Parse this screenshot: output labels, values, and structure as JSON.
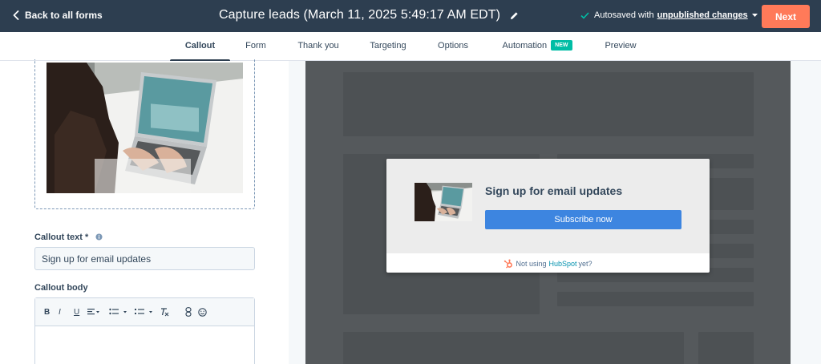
{
  "topbar": {
    "back_label": "Back to all forms",
    "title": "Capture leads (March 11, 2025 5:49:17 AM EDT)",
    "autosave_text": "Autosaved with",
    "autosave_link": "unpublished changes",
    "next_label": "Next"
  },
  "tabs": [
    {
      "label": "Callout",
      "active": true
    },
    {
      "label": "Form"
    },
    {
      "label": "Thank you"
    },
    {
      "label": "Targeting"
    },
    {
      "label": "Options"
    },
    {
      "label": "Automation",
      "badge": "NEW"
    },
    {
      "label": "Preview"
    }
  ],
  "editor": {
    "callout_text_label": "Callout text *",
    "callout_text_value": "Sign up for email updates",
    "callout_body_label": "Callout body",
    "toolbar": {
      "bold": "B",
      "italic": "I",
      "underline": "U",
      "icons": [
        "align-icon",
        "bulleted-list-icon",
        "numbered-list-icon",
        "clear-format-icon",
        "link-icon",
        "emoji-icon"
      ]
    }
  },
  "popup": {
    "heading": "Sign up for email updates",
    "button_label": "Subscribe now",
    "footer_text": "Not using",
    "footer_brand": "HubSpot",
    "footer_suffix": "yet?"
  },
  "colors": {
    "topbar": "#2d3e50",
    "accent_orange": "#ff7a59",
    "badge_teal": "#00bda5",
    "popup_button": "#3d85e0",
    "canvas": "#55595c"
  }
}
